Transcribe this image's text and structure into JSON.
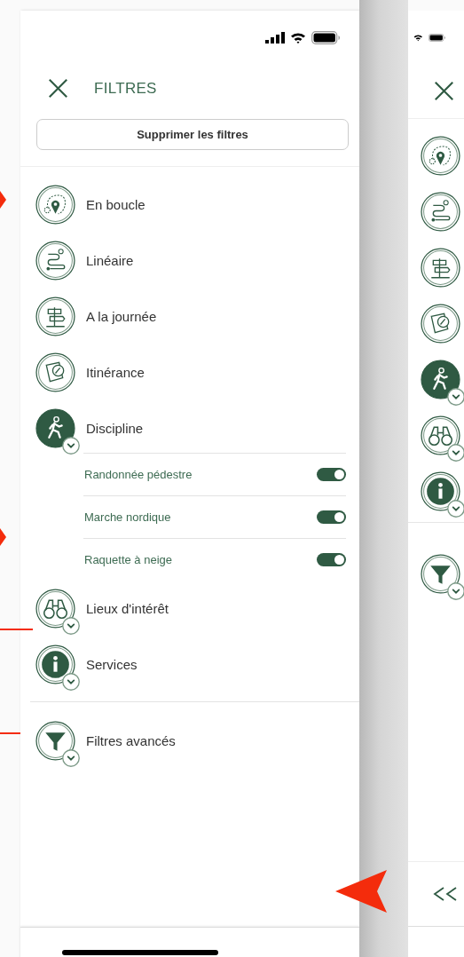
{
  "filters_panel": {
    "title": "FILTRES",
    "clear_button": "Supprimer les filtres",
    "filters": [
      {
        "label": "En boucle",
        "kind": "loop",
        "selected": false,
        "expandable": false
      },
      {
        "label": "Linéaire",
        "kind": "linear",
        "selected": false,
        "expandable": false
      },
      {
        "label": "A la journée",
        "kind": "signpost",
        "selected": false,
        "expandable": false
      },
      {
        "label": "Itinérance",
        "kind": "map",
        "selected": false,
        "expandable": false
      },
      {
        "label": "Discipline",
        "kind": "hiker",
        "selected": true,
        "expandable": true,
        "children": [
          {
            "label": "Randonnée pédestre",
            "on": true
          },
          {
            "label": "Marche nordique",
            "on": true
          },
          {
            "label": "Raquette à neige",
            "on": true
          }
        ]
      },
      {
        "label": "Lieux d'intérêt",
        "kind": "binoculars",
        "selected": false,
        "expandable": true
      },
      {
        "label": "Services",
        "kind": "info",
        "selected": false,
        "expandable": true
      }
    ],
    "advanced": {
      "label": "Filtres avancés",
      "kind": "funnel",
      "selected": false,
      "expandable": true
    }
  },
  "collapsed_panel": {
    "filters": [
      {
        "kind": "loop",
        "selected": false,
        "expandable": false
      },
      {
        "kind": "linear",
        "selected": false,
        "expandable": false
      },
      {
        "kind": "signpost",
        "selected": false,
        "expandable": false
      },
      {
        "kind": "map",
        "selected": false,
        "expandable": false
      },
      {
        "kind": "hiker",
        "selected": true,
        "expandable": true
      },
      {
        "kind": "binoculars",
        "selected": false,
        "expandable": true
      },
      {
        "kind": "info",
        "selected": false,
        "expandable": true
      }
    ],
    "advanced": {
      "kind": "funnel",
      "selected": false,
      "expandable": true
    }
  }
}
